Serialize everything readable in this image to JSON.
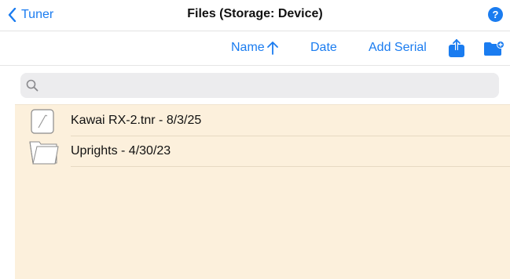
{
  "nav": {
    "back_label": "Tuner",
    "title": "Files (Storage: Device)",
    "help_label": "?"
  },
  "toolbar": {
    "sort_name_label": "Name",
    "sort_date_label": "Date",
    "add_serial_label": "Add Serial",
    "share_icon": "share-icon",
    "new_folder_icon": "new-folder-icon"
  },
  "search": {
    "value": "",
    "placeholder": ""
  },
  "files": [
    {
      "name": "Kawai RX-2.tnr - 8/3/25",
      "icon": "document-icon"
    },
    {
      "name": "Uprights - 4/30/23",
      "icon": "folder-icon"
    }
  ],
  "colors": {
    "accent": "#1a7cf0",
    "list_background": "#fcf0dc"
  }
}
